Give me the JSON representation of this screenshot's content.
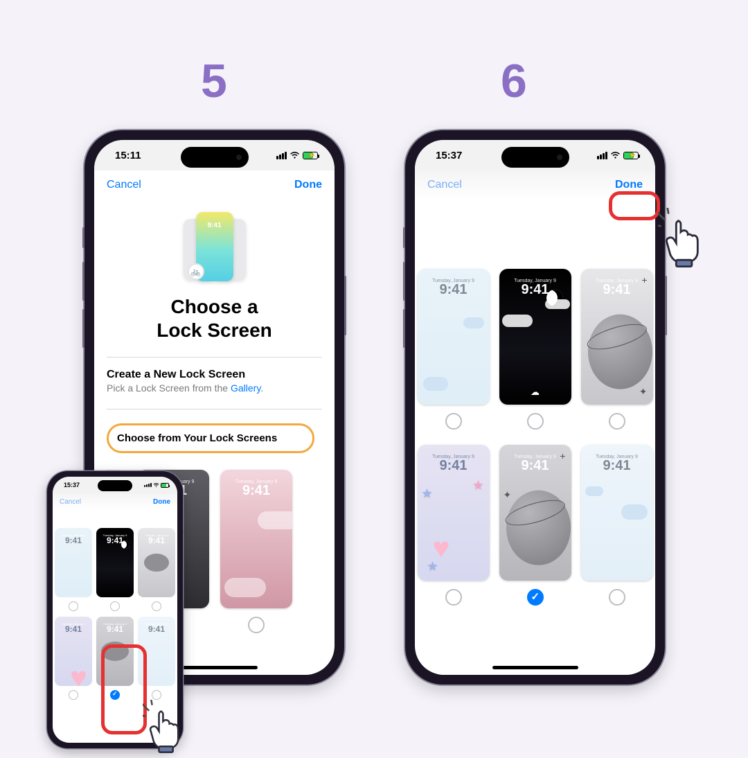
{
  "steps": {
    "s5": "5",
    "s6": "6"
  },
  "common": {
    "preview_date": "Tuesday, January 9",
    "preview_time": "9:41",
    "cancel": "Cancel",
    "done": "Done"
  },
  "phone_a": {
    "status_time": "15:11",
    "title_line1": "Choose a",
    "title_line2": "Lock Screen",
    "hero_time": "9:41",
    "create_title": "Create a New Lock Screen",
    "create_sub_prefix": "Pick a Lock Screen from the ",
    "create_sub_link": "Gallery",
    "choose_label": "Choose from Your Lock Screens",
    "cards": [
      {
        "kind": "heart"
      },
      {
        "kind": "pink-clouds"
      }
    ]
  },
  "mini_phone": {
    "status_time": "15:37",
    "row1": [
      "lightblue",
      "night",
      "gray-planet"
    ],
    "row2": [
      "stars-heart",
      "gray-planet-dark",
      "sky"
    ],
    "selected_index_row2": 1
  },
  "phone_b": {
    "status_time": "15:37",
    "rows": [
      {
        "cards": [
          "lightblue",
          "night",
          "gray-planet"
        ],
        "radios": [
          false,
          false,
          false
        ]
      },
      {
        "cards": [
          "stars-heart",
          "gray-planet-dark",
          "sky"
        ],
        "radios": [
          false,
          true,
          false
        ]
      }
    ]
  }
}
